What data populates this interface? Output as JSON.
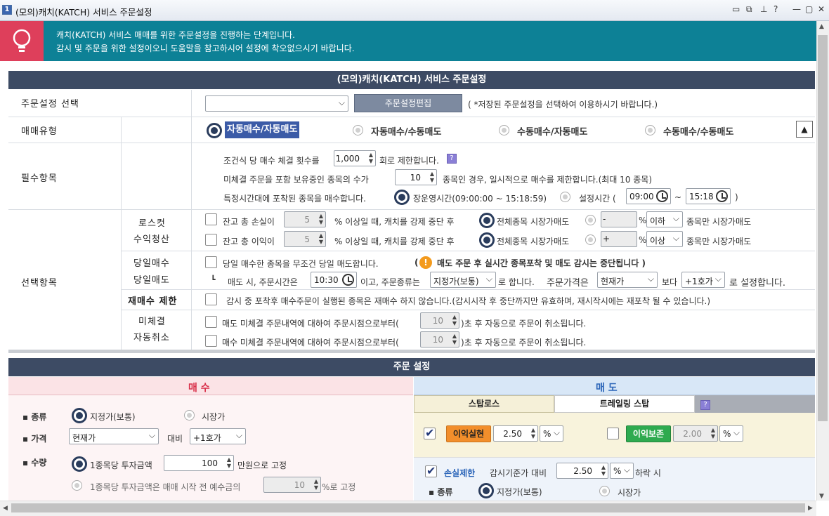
{
  "window": {
    "number": "1",
    "title": "(모의)캐치(KATCH) 서비스 주문설정"
  },
  "banner": {
    "line1": "캐치(KATCH) 서비스 매매를 위한 주문설정을 진행하는 단계입니다.",
    "line2": "감시 및 주문을 위한 설정이오니 도움말을 참고하시어 설정에 착오없으시기 바랍니다."
  },
  "top_section": {
    "title": "(모의)캐치(KATCH) 서비스 주문설정"
  },
  "order_select": {
    "label": "주문설정 선택",
    "edit_button": "주문설정편집",
    "hint": "( *저장된 주문설정을 선택하여 이용하시기 바랍니다.)",
    "value": ""
  },
  "trade_type": {
    "label": "매매유형",
    "options": [
      "자동매수/자동매도",
      "자동매수/수동매도",
      "수동매수/자동매도",
      "수동매수/수동매도"
    ],
    "selected": "자동매수/자동매도",
    "collapse_glyph": "▲"
  },
  "required": {
    "label": "필수항목",
    "row1_pre": "조건식 당 매수 체결 횟수를",
    "row1_value": "1,000",
    "row1_post": "회로 제한합니다.",
    "row2_pre": "미체결 주문을 포함 보유중인 종목의 수가",
    "row2_value": "10",
    "row2_post": "종목인 경우, 일시적으로 매수를 제한합니다.(최대 10 종목)",
    "row3_pre": "특정시간대에 포착된 종목을 매수합니다.",
    "row3_opt1": "장운영시간(09:00:00 ~ 15:18:59)",
    "row3_opt2": "설정시간 (",
    "row3_from": "09:00",
    "row3_tilde": "~",
    "row3_to": "15:18",
    "row3_close": ")"
  },
  "optional": {
    "label": "선택항목",
    "losscut": {
      "label1": "로스컷",
      "label2": "수익청산",
      "loss_text": "잔고 총 손실이",
      "loss_value": "5",
      "profit_text": "잔고 총 이익이",
      "profit_value": "5",
      "mid_text": "% 이상일 때, 캐치를 강제 중단 후",
      "market_sell": "전체종목 시장가매도",
      "sign_minus": "-",
      "sign_plus": "+",
      "pct": "%",
      "cmp_below": "이하",
      "cmp_above": "이상",
      "tail": "종목만 시장가매도"
    },
    "daytrade": {
      "label1": "당일매수",
      "label2": "당일매도",
      "text": "당일 매수한 종목을 무조건 당일 매도합니다.",
      "warn_open": "(",
      "warn": "매도 주문 후 실시간 종목포착 및 매도 감시는 중단됩니다 )",
      "sub_pre": "매도 시, 주문시간은",
      "time": "10:30",
      "sub_mid": "이고, 주문종류는",
      "order_kind": "지정가(보통)",
      "sub_mid2": "로 합니다.",
      "price_label": "주문가격은",
      "price_sel": "현재가",
      "than": "보다",
      "tick_sel": "+1호가",
      "tail": "로 설정합니다."
    },
    "rebuy": {
      "label": "재매수 제한",
      "text": "감시 중 포착후 매수주문이 실행된 종목은 재매수 하지 않습니다.(감시시작 후 중단까지만 유효하며, 재시작시에는 재포착 될 수 있습니다.)"
    },
    "unfilled": {
      "label1": "미체결",
      "label2": "자동취소",
      "sell_text": "매도 미체결 주문내역에 대하여 주문시점으로부터(",
      "sell_value": "10",
      "buy_text": "매수 미체결 주문내역에 대하여 주문시점으로부터(",
      "buy_value": "10",
      "tail": ")초 후 자동으로 주문이 취소됩니다."
    }
  },
  "order_section": {
    "title": "주문 설정"
  },
  "buy": {
    "header": "매 수",
    "kind_label": "종류",
    "kind_opt1": "지정가(보통)",
    "kind_opt2": "시장가",
    "price_label": "가격",
    "price_sel": "현재가",
    "vs": "대비",
    "tick_sel": "+1호가",
    "qty_label": "수량",
    "qty_opt1": "1종목당 투자금액",
    "qty_value": "100",
    "qty_unit": "만원으로 고정",
    "qty_opt2": "1종목당 투자금액은 매매 시작 전 예수금의",
    "qty_pct": "10",
    "qty_pct_unit": "%로 고정"
  },
  "sell": {
    "header": "매 도",
    "tab1": "스탑로스",
    "tab2": "트레일링 스탑",
    "profit_btn": "이익실현",
    "profit_value": "2.50",
    "profit_unit": "%",
    "protect_btn": "이익보존",
    "protect_value": "2.00",
    "protect_unit": "%",
    "stoploss_label": "손실제한",
    "stoploss_text": "감시기준가 대비",
    "stoploss_value": "2.50",
    "stoploss_unit": "%",
    "stoploss_tail": "하락 시",
    "kind_label": "종류",
    "kind_opt1": "지정가(보통)",
    "kind_opt2": "시장가"
  },
  "colors": {
    "banner": "#0d8196",
    "banner_icon": "#de3f5b",
    "section_bar": "#3d4b64",
    "buy_accent": "#d9304a",
    "sell_accent": "#2a64b8",
    "profit_btn": "#f28e2b",
    "protect_btn": "#2eaa4f"
  },
  "icons": {
    "banner": "lightbulb-icon",
    "target": "target-icon",
    "clock": "clock-icon",
    "help": "help-icon"
  }
}
